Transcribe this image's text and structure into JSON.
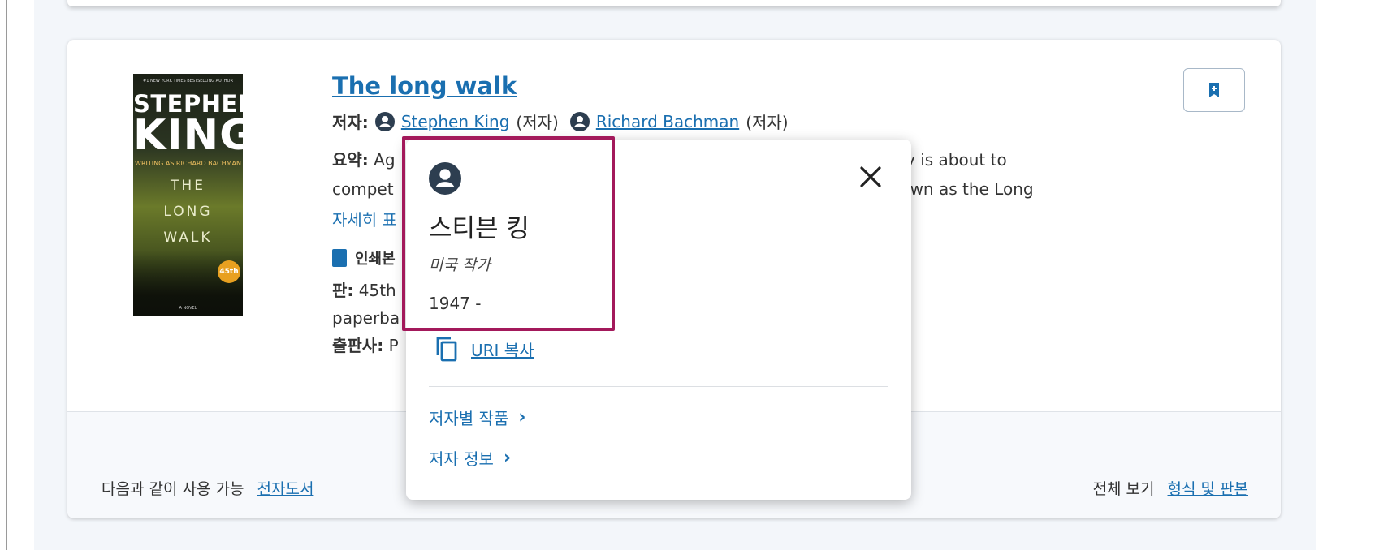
{
  "book": {
    "title": "The long walk",
    "authors_label": "저자:",
    "author1": "Stephen King",
    "author1_role": "(저자)",
    "author2": "Richard Bachman",
    "author2_role": "(저자)",
    "summary_label": "요약:",
    "summary_line1_start": "Ag",
    "summary_line1_end": "arraty is about to",
    "summary_line2_start": "compet",
    "summary_line2_end": "wn as the Long",
    "more_link": "자세히 표",
    "format_label": "인쇄본",
    "edition_label": "판:",
    "edition_value": "45th",
    "binding_value": "paperba",
    "publisher_label": "출판사:",
    "publisher_value": "P",
    "cover": {
      "top_text": "#1 NEW YORK TIMES BESTSELLING AUTHOR",
      "author_first": "STEPHEN",
      "author_last": "KING",
      "writing_as": "WRITING AS RICHARD BACHMAN",
      "title_line1": "THE",
      "title_line2": "LONG",
      "title_line3": "WALK",
      "badge": "45th",
      "bottom": "A NOVEL"
    }
  },
  "footer": {
    "available_text": "다음과 같이 사용 가능",
    "available_link": "전자도서",
    "view_all_text": "전체 보기",
    "view_all_link": "형식 및 판본"
  },
  "popup": {
    "name": "스티븐 킹",
    "description": "미국 작가",
    "years": "1947 -",
    "copy_uri": "URI 복사",
    "works_link": "저자별 작품",
    "info_link": "저자 정보"
  },
  "icons": {
    "bookmark": "bookmark-icon",
    "person": "person-icon",
    "close": "close-icon",
    "copy": "copy-icon",
    "chevron": "chevron-right-icon"
  },
  "colors": {
    "link": "#1a6fb0",
    "icon_dark": "#2d3e50",
    "highlight": "#a3195b"
  }
}
